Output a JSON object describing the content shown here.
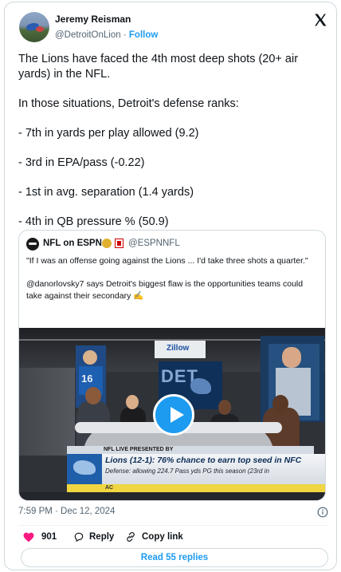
{
  "author": {
    "name": "Jeremy Reisman",
    "handle": "@DetroitOnLion",
    "separator": "·",
    "follow_label": "Follow"
  },
  "tweet": {
    "lines": [
      "The Lions have faced the 4th most deep shots (20+ air yards) in the NFL.",
      "In those situations, Detroit's defense ranks:",
      "- 7th in yards per play allowed (9.2)",
      "- 3rd in EPA/pass (-0.22)",
      "- 1st in avg. separation (1.4 yards)",
      "- 4th in QB pressure % (50.9)"
    ]
  },
  "quoted": {
    "name": "NFL on ESPN",
    "handle": "@ESPNNFL",
    "text_1": "\"If I was an offense going against the Lions ... I'd take three shots a quarter.\"",
    "text_2": "@danorlovsky7 says Detroit's biggest flaw is the opportunities teams could take against their secondary ✍️",
    "video": {
      "sponsor": "Zillow",
      "screen_letters": "DET",
      "jersey_number": "16",
      "chyron_label": "NFL LIVE PRESENTED BY",
      "chyron_headline": "Lions (12-1): 76% chance to earn top seed in NFC",
      "chyron_sub": "Defense: allowing 224.7 Pass yds PG this season (23rd in",
      "chyron_ticker": "AC"
    }
  },
  "meta": {
    "timestamp": "7:59 PM · Dec 12, 2024"
  },
  "actions": {
    "like_count": "901",
    "reply_label": "Reply",
    "copy_link_label": "Copy link",
    "read_replies_label": "Read 55 replies"
  },
  "colors": {
    "accent": "#1d9bf0",
    "like": "#f91880",
    "muted": "#536471",
    "border": "#cfd9de"
  },
  "icons": [
    "x-logo-icon",
    "info-icon",
    "heart-icon",
    "reply-icon",
    "link-icon",
    "play-icon"
  ]
}
